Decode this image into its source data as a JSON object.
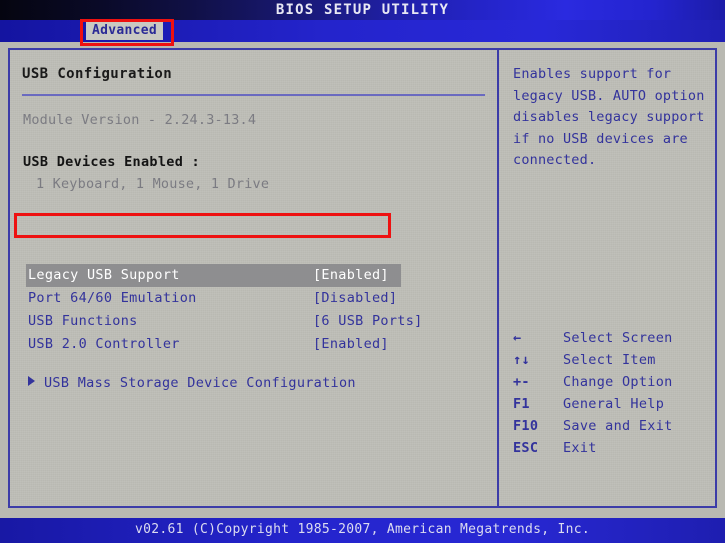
{
  "window": {
    "title": "BIOS SETUP UTILITY",
    "footer": "v02.61 (C)Copyright 1985-2007, American Megatrends, Inc."
  },
  "tabs": {
    "active": "Advanced"
  },
  "main": {
    "section_title": "USB Configuration",
    "module_version": "Module Version - 2.24.3-13.4",
    "devices_label": "USB Devices Enabled :",
    "devices_list": "1 Keyboard, 1 Mouse, 1 Drive",
    "options": [
      {
        "label": "Legacy USB Support",
        "value": "[Enabled]",
        "selected": true
      },
      {
        "label": "Port 64/60 Emulation",
        "value": "[Disabled]",
        "selected": false
      },
      {
        "label": "USB Functions",
        "value": "[6 USB Ports]",
        "selected": false
      },
      {
        "label": "USB 2.0 Controller",
        "value": "[Enabled]",
        "selected": false
      }
    ],
    "submenu": "USB Mass Storage Device Configuration"
  },
  "help": {
    "text": "Enables support for legacy USB. AUTO option disables legacy support if no USB devices are connected.",
    "keys": [
      {
        "key": "←",
        "desc": "Select Screen"
      },
      {
        "key": "↑↓",
        "desc": "Select Item"
      },
      {
        "key": "+-",
        "desc": "Change Option"
      },
      {
        "key": "F1",
        "desc": "General Help"
      },
      {
        "key": "F10",
        "desc": "Save and Exit"
      },
      {
        "key": "ESC",
        "desc": "Exit"
      }
    ]
  },
  "colors": {
    "accent_blue": "#33339c",
    "titlebar_blue": "#2424c8",
    "panel_bg": "#b9b9b2",
    "selection_bg": "#8e8e90",
    "annotation_red": "#ee1111"
  }
}
